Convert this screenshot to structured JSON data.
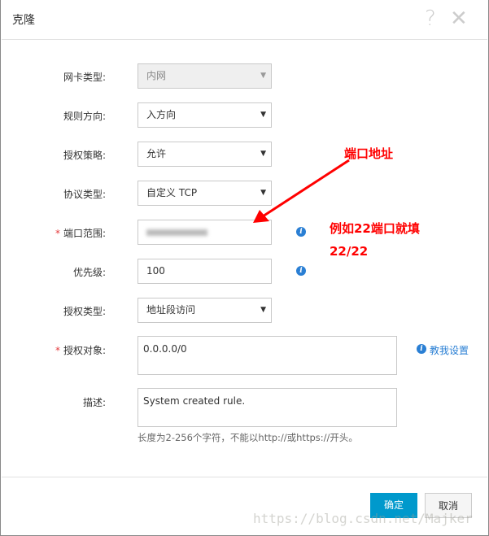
{
  "dialog": {
    "title": "克隆",
    "help_icon": "question-icon",
    "close_icon": "close-icon"
  },
  "form": {
    "nic_type": {
      "label": "网卡类型:",
      "value": "内网"
    },
    "direction": {
      "label": "规则方向:",
      "value": "入方向"
    },
    "policy": {
      "label": "授权策略:",
      "value": "允许"
    },
    "protocol": {
      "label": "协议类型:",
      "value": "自定义 TCP"
    },
    "port_range": {
      "label": "端口范围:",
      "required": "*"
    },
    "priority": {
      "label": "优先级:",
      "value": "100"
    },
    "auth_type": {
      "label": "授权类型:",
      "value": "地址段访问"
    },
    "auth_object": {
      "label": "授权对象:",
      "required": "*",
      "value": "0.0.0.0/0",
      "help_link": "教我设置"
    },
    "description": {
      "label": "描述:",
      "value": "System created rule.",
      "hint": "长度为2-256个字符，不能以http://或https://开头。"
    }
  },
  "annotations": {
    "arrow_label": "端口地址",
    "example_line1": "例如22端口就填",
    "example_line2": "22/22"
  },
  "footer": {
    "confirm": "确定",
    "cancel": "取消"
  },
  "watermark": "https://blog.csdn.net/Majker",
  "colors": {
    "primary": "#0099cc",
    "annotation": "#ff0000",
    "info": "#2a7fd4"
  }
}
